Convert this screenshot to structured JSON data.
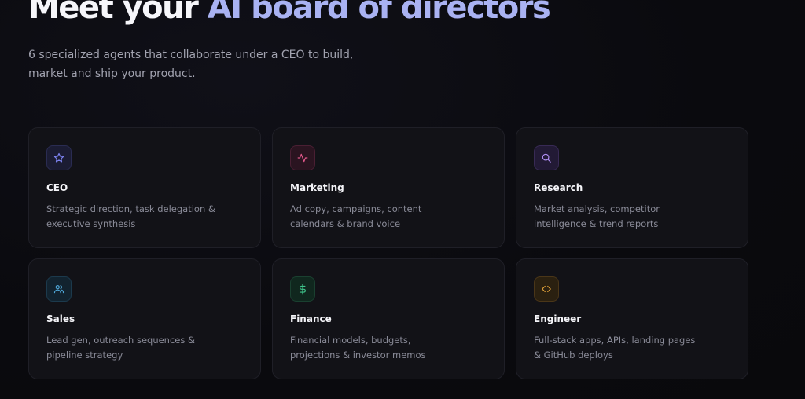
{
  "hero": {
    "title_prefix": "Meet your ",
    "title_accent": "AI board of directors",
    "subtitle": "6 specialized agents that collaborate under a CEO to build, market and ship your product."
  },
  "agents": [
    {
      "name": "CEO",
      "description": "Strategic direction, task delegation & executive synthesis",
      "icon": "star-icon",
      "accent_color": "#7c82f0",
      "icon_bg": "#1b1c33",
      "icon_border": "#2a2c52"
    },
    {
      "name": "Marketing",
      "description": "Ad copy, campaigns, content calendars & brand voice",
      "icon": "activity-icon",
      "accent_color": "#e0578a",
      "icon_bg": "#2a1420",
      "icon_border": "#4a1f33"
    },
    {
      "name": "Research",
      "description": "Market analysis, competitor intelligence & trend reports",
      "icon": "search-icon",
      "accent_color": "#b08ef2",
      "icon_bg": "#221a35",
      "icon_border": "#382a55"
    },
    {
      "name": "Sales",
      "description": "Lead gen, outreach sequences & pipeline strategy",
      "icon": "users-icon",
      "accent_color": "#4fa7d8",
      "icon_bg": "#12232f",
      "icon_border": "#1c3a4d"
    },
    {
      "name": "Finance",
      "description": "Financial models, budgets, projections & investor memos",
      "icon": "dollar-icon",
      "accent_color": "#3fc48b",
      "icon_bg": "#10271e",
      "icon_border": "#1a4030"
    },
    {
      "name": "Engineer",
      "description": "Full-stack apps, APIs, landing pages & GitHub deploys",
      "icon": "code-icon",
      "accent_color": "#e8a63a",
      "icon_bg": "#2a2010",
      "icon_border": "#4a3618"
    }
  ]
}
